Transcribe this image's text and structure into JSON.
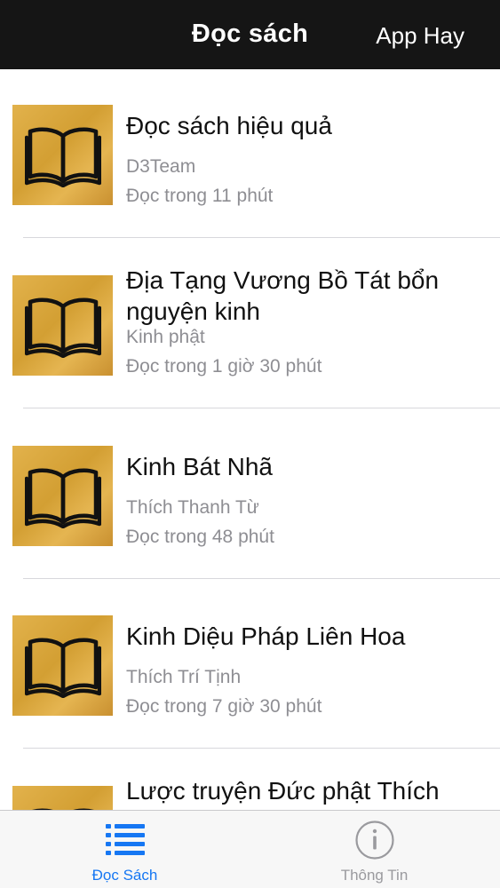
{
  "navbar": {
    "title": "Đọc sách",
    "right_button": "App Hay"
  },
  "books": [
    {
      "title": "Đọc sách hiệu quả",
      "author": "D3Team",
      "duration": "Đọc trong 11 phút",
      "cover_icon": "book-icon"
    },
    {
      "title": "Địa Tạng Vương Bồ Tát bổn nguyện kinh",
      "author": "Kinh phật",
      "duration": "Đọc trong 1 giờ 30 phút",
      "cover_icon": "book-icon"
    },
    {
      "title": "Kinh Bát Nhã",
      "author": "Thích Thanh Từ",
      "duration": "Đọc trong 48 phút",
      "cover_icon": "book-icon"
    },
    {
      "title": "Kinh Diệu Pháp Liên Hoa",
      "author": "Thích Trí Tịnh",
      "duration": "Đọc trong 7 giờ 30 phút",
      "cover_icon": "book-icon"
    },
    {
      "title": "Lược truyện Đức phật Thích",
      "author": "",
      "duration": "",
      "cover_icon": "book-icon"
    }
  ],
  "tabbar": {
    "tabs": [
      {
        "label": "Đọc Sách",
        "icon": "list-icon",
        "active": true
      },
      {
        "label": "Thông Tin",
        "icon": "info-icon",
        "active": false
      }
    ]
  },
  "colors": {
    "navbar_bg": "#151515",
    "accent": "#1677f3",
    "cover_gold": "#d9a63d",
    "secondary_text": "#8e8e93"
  }
}
